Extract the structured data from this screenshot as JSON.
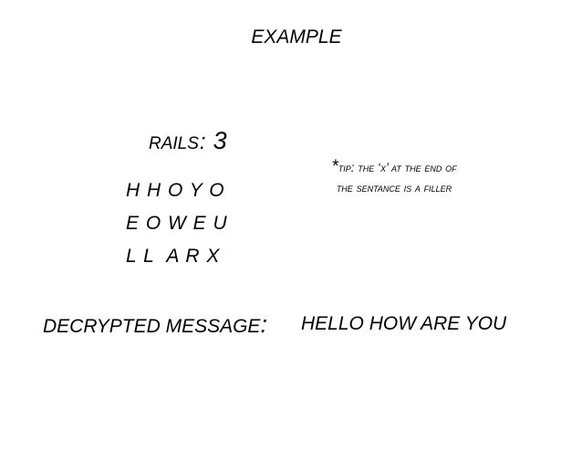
{
  "title": "EXAMPLE",
  "rails": {
    "label": "RAILS",
    "colon": ":",
    "value": "3"
  },
  "grid": {
    "rows": [
      "H H O Y O",
      "E O W E U",
      "L L  A R X"
    ]
  },
  "tip": {
    "star": "*",
    "head": "tip",
    "text": ": the ‘x’ at the end of the sentance is a filler"
  },
  "result": {
    "label": "DECRYPTED MESSAGE",
    "colon": ":",
    "message": "HELLO HOW ARE YOU"
  }
}
